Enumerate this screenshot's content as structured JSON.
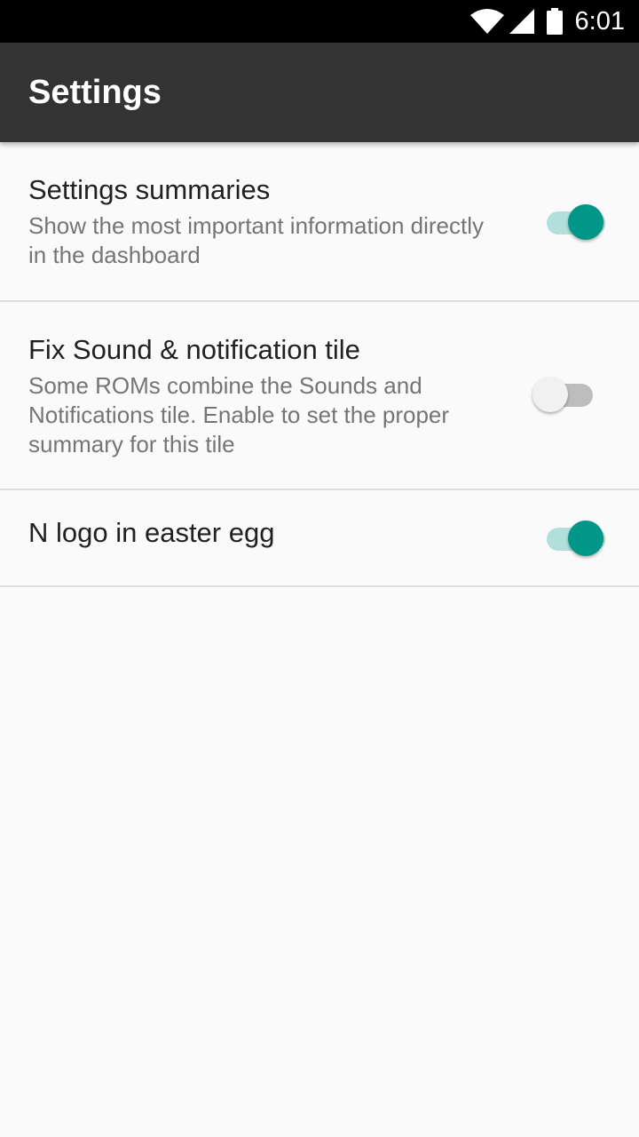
{
  "status_bar": {
    "time": "6:01",
    "icons": [
      "wifi-icon",
      "cell-signal-icon",
      "battery-icon"
    ]
  },
  "app_bar": {
    "title": "Settings"
  },
  "preferences": [
    {
      "title": "Settings summaries",
      "summary": "Show the most important information directly in the dashboard",
      "enabled": true
    },
    {
      "title": "Fix Sound & notification tile",
      "summary": "Some ROMs combine the Sounds and Notifications tile. Enable to set the proper summary for this tile",
      "enabled": false
    },
    {
      "title": "N logo in easter egg",
      "summary": "",
      "enabled": true
    }
  ],
  "colors": {
    "accent": "#009688",
    "accent_track": "#b2dfdb",
    "app_bar": "#333333",
    "background": "#fafafa"
  }
}
